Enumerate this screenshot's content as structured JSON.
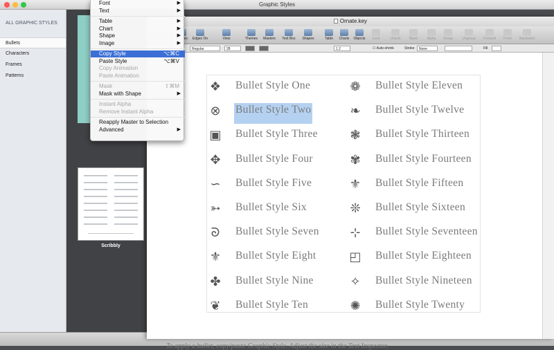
{
  "outer_window": {
    "title": "Graphic Styles"
  },
  "sidebar": {
    "header": "ALL GRAPHIC STYLES",
    "items": [
      {
        "label": "Bullets"
      },
      {
        "label": "Characters"
      },
      {
        "label": "Frames"
      },
      {
        "label": "Patterns"
      }
    ]
  },
  "gallery": {
    "thumb_label": "Scribbly"
  },
  "document": {
    "title": "Ornate.key",
    "toolbar": [
      {
        "label": "Guides",
        "icon": "guides-icon",
        "enabled": true
      },
      {
        "label": "Edges On",
        "icon": "edges-icon",
        "enabled": true
      },
      {
        "label": "View",
        "icon": "view-icon",
        "enabled": true
      },
      {
        "label": "Themes",
        "icon": "themes-icon",
        "enabled": true
      },
      {
        "label": "Masters",
        "icon": "masters-icon",
        "enabled": true
      },
      {
        "label": "Text Box",
        "icon": "text-box-icon",
        "enabled": true
      },
      {
        "label": "Shapes",
        "icon": "shapes-icon",
        "enabled": true
      },
      {
        "label": "Table",
        "icon": "table-icon",
        "enabled": true
      },
      {
        "label": "Charts",
        "icon": "charts-icon",
        "enabled": true
      },
      {
        "label": "Objects",
        "icon": "objects-icon",
        "enabled": true
      },
      {
        "label": "Lock",
        "icon": "lock-icon",
        "enabled": false
      },
      {
        "label": "Unlock",
        "icon": "unlock-icon",
        "enabled": false
      },
      {
        "label": "Mask",
        "icon": "mask-icon",
        "enabled": false
      },
      {
        "label": "Alpha",
        "icon": "alpha-icon",
        "enabled": false
      },
      {
        "label": "Group",
        "icon": "group-icon",
        "enabled": false
      },
      {
        "label": "Ungroup",
        "icon": "ungroup-icon",
        "enabled": false
      },
      {
        "label": "Forward",
        "icon": "forward-icon",
        "enabled": false
      },
      {
        "label": "Front",
        "icon": "front-icon",
        "enabled": false
      },
      {
        "label": "Backward",
        "icon": "backward-icon",
        "enabled": false
      }
    ],
    "format_bar": {
      "style": "Regular",
      "size": "28",
      "line_spacing": "1.2",
      "autoshrink_label": "Auto-shrink",
      "stroke_label": "Stroke",
      "stroke_value": "None",
      "fill_label": "Fill"
    },
    "bullets_left": [
      {
        "name": "Bullet Style One",
        "icon": "square-flower-icon",
        "glyph": "❖"
      },
      {
        "name": "Bullet Style Two",
        "icon": "circle-cross-icon",
        "glyph": "⊗"
      },
      {
        "name": "Bullet Style Three",
        "icon": "square-ornament-icon",
        "glyph": "▣"
      },
      {
        "name": "Bullet Style Four",
        "icon": "corner-flourish-icon",
        "glyph": "✥"
      },
      {
        "name": "Bullet Style Five",
        "icon": "swirl-line-icon",
        "glyph": "∽"
      },
      {
        "name": "Bullet Style Six",
        "icon": "arrow-flourish-icon",
        "glyph": "➳"
      },
      {
        "name": "Bullet Style Seven",
        "icon": "scroll-swirl-icon",
        "glyph": "ᘐ"
      },
      {
        "name": "Bullet Style Eight",
        "icon": "scroll-vine-icon",
        "glyph": "⚜"
      },
      {
        "name": "Bullet Style Nine",
        "icon": "leaf-cross-icon",
        "glyph": "✤"
      },
      {
        "name": "Bullet Style Ten",
        "icon": "curl-flourish-icon",
        "glyph": "❦"
      }
    ],
    "bullets_right": [
      {
        "name": "Bullet Style Eleven",
        "icon": "leaf-circle-icon",
        "glyph": "❁"
      },
      {
        "name": "Bullet Style Twelve",
        "icon": "heart-leaf-icon",
        "glyph": "❧"
      },
      {
        "name": "Bullet Style Thirteen",
        "icon": "flower-star-icon",
        "glyph": "❃"
      },
      {
        "name": "Bullet Style Fourteen",
        "icon": "sprig-icon",
        "glyph": "✾"
      },
      {
        "name": "Bullet Style Fifteen",
        "icon": "fleur-de-lis-icon",
        "glyph": "⚜"
      },
      {
        "name": "Bullet Style Sixteen",
        "icon": "vine-flourish-icon",
        "glyph": "❊"
      },
      {
        "name": "Bullet Style Seventeen",
        "icon": "pin-flourish-icon",
        "glyph": "⊹"
      },
      {
        "name": "Bullet Style Eighteen",
        "icon": "corner-square-icon",
        "glyph": "◰"
      },
      {
        "name": "Bullet Style Nineteen",
        "icon": "four-point-star-icon",
        "glyph": "✧"
      },
      {
        "name": "Bullet Style Twenty",
        "icon": "flower-burst-icon",
        "glyph": "✺"
      }
    ],
    "selected_text": "Bullet Style Two",
    "caption": "To apply a bullet, copy/paste Graphic Style. Adjust the size in the Text Inspector."
  },
  "format_menu": {
    "items": [
      {
        "label": "Font",
        "submenu": true,
        "enabled": true
      },
      {
        "label": "Text",
        "submenu": true,
        "enabled": true
      },
      {
        "sep": true
      },
      {
        "label": "Table",
        "submenu": true,
        "enabled": true
      },
      {
        "label": "Chart",
        "submenu": true,
        "enabled": true
      },
      {
        "label": "Shape",
        "submenu": true,
        "enabled": true
      },
      {
        "label": "Image",
        "submenu": true,
        "enabled": true
      },
      {
        "sep": true
      },
      {
        "label": "Copy Style",
        "shortcut": "⌥⌘C",
        "enabled": true,
        "highlighted": true
      },
      {
        "label": "Paste Style",
        "shortcut": "⌥⌘V",
        "enabled": true
      },
      {
        "label": "Copy Animation",
        "enabled": false
      },
      {
        "label": "Paste Animation",
        "enabled": false
      },
      {
        "sep": true
      },
      {
        "label": "Mask",
        "shortcut": "⇧⌘M",
        "enabled": false
      },
      {
        "label": "Mask with Shape",
        "submenu": true,
        "enabled": true
      },
      {
        "sep": true
      },
      {
        "label": "Instant Alpha",
        "enabled": false
      },
      {
        "label": "Remove Instant Alpha",
        "enabled": false
      },
      {
        "sep": true
      },
      {
        "label": "Reapply Master to Selection",
        "enabled": true
      },
      {
        "label": "Advanced",
        "submenu": true,
        "enabled": true
      }
    ]
  },
  "colors": {
    "menu_highlight": "#3b6fd6",
    "selection": "#b5d1f1",
    "thumb_teal": "#8ecfc5"
  }
}
